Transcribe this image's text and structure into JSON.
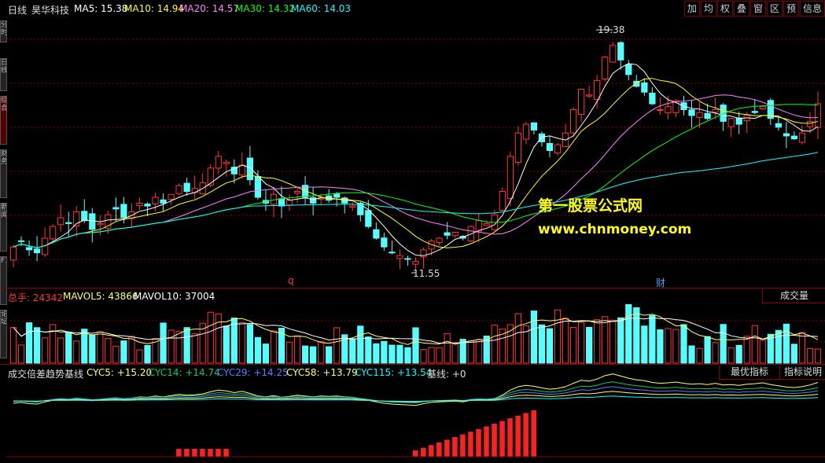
{
  "header": {
    "period": "日线",
    "stock_name": "昊华科技",
    "ma5": "MA5: 15.38",
    "ma10": "MA10: 14.94",
    "ma20": "MA20: 14.57",
    "ma30": "MA30: 14.32",
    "ma60": "MA60: 14.03"
  },
  "toolbar": [
    "加",
    "均",
    "权",
    "叠",
    "窗",
    "区",
    "预",
    "信息"
  ],
  "left_tabs": [
    "分时",
    "日线",
    "综合",
    "财务",
    "新闻",
    "F10",
    "论坛"
  ],
  "price_panel": {
    "high_label": "19.38",
    "low_label": "11.55",
    "event_q": "q",
    "event_cai": "财"
  },
  "volume_panel": {
    "total": "总手: 24342",
    "mavol5": "MAVOL5: 43866",
    "mavol10": "MAVOL10: 37004",
    "button": "成交量"
  },
  "indicator_panel": {
    "name": "成交倍差趋势基线",
    "cyc5": "CYC5: +15.20",
    "cyc14": "CYC14: +14.74",
    "cyc29": "CYC29: +14.25",
    "cyc58": "CYC58: +13.79",
    "cyc115": "CYC115: +13.54",
    "base": "基线: +0",
    "btn_best": "最优指标",
    "btn_help": "指标说明"
  },
  "watermark": {
    "line1": "第一股票公式网",
    "line2": "www.chnmoney.com"
  },
  "colors": {
    "up": "#ff3333",
    "down": "#54ffff",
    "ma5": "#ffffff",
    "ma10": "#ffff00",
    "ma20": "#ff80ff",
    "ma30": "#00ff00",
    "ma60": "#00ffff",
    "grid": "#8a0000"
  },
  "chart_data": {
    "type": "candlestick",
    "closes": [
      12.1,
      12.3,
      12.0,
      11.9,
      12.4,
      12.8,
      13.1,
      12.9,
      13.3,
      13.0,
      12.7,
      12.9,
      13.2,
      13.4,
      13.1,
      13.3,
      13.6,
      13.5,
      13.8,
      13.6,
      13.9,
      14.2,
      14.0,
      14.1,
      14.3,
      14.8,
      15.2,
      15.0,
      14.6,
      14.9,
      14.4,
      13.8,
      13.6,
      13.9,
      13.5,
      13.7,
      14.0,
      13.8,
      13.6,
      13.8,
      13.7,
      13.8,
      13.6,
      13.5,
      13.2,
      12.8,
      12.4,
      12.1,
      11.9,
      11.8,
      11.7,
      11.6,
      12.0,
      12.3,
      12.4,
      12.5,
      12.6,
      12.4,
      12.8,
      13.0,
      12.9,
      13.2,
      14.0,
      15.2,
      16.0,
      16.3,
      16.1,
      15.7,
      15.4,
      15.6,
      16.0,
      16.8,
      17.5,
      17.3,
      17.8,
      18.6,
      19.0,
      18.5,
      18.0,
      17.6,
      17.4,
      17.0,
      16.8,
      16.9,
      17.1,
      16.8,
      16.6,
      16.7,
      16.5,
      16.8,
      16.4,
      16.5,
      16.3,
      16.6,
      16.7,
      16.9,
      16.5,
      16.2,
      15.9,
      15.8,
      16.0,
      16.4,
      17.0
    ]
  }
}
